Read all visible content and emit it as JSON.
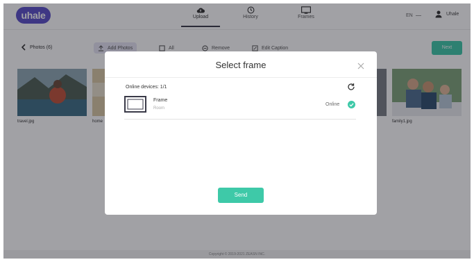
{
  "app": {
    "logo_text": "uhale",
    "nav": [
      {
        "label": "Upload",
        "icon": "cloud-upload-icon",
        "active": true
      },
      {
        "label": "History",
        "icon": "clock-icon",
        "active": false
      },
      {
        "label": "Frames",
        "icon": "frame-icon",
        "active": false
      }
    ],
    "language": "EN",
    "username": "Uhale"
  },
  "toolbar": {
    "back_label": "Photos (6)",
    "add_photos_label": "Add Photos",
    "all_label": "All",
    "remove_label": "Remove",
    "edit_caption_label": "Edit Caption",
    "next_label": "Next"
  },
  "photos": [
    {
      "caption": "travel.jpg",
      "icon": "photo-thumbnail"
    },
    {
      "caption": "home",
      "icon": "photo-thumbnail"
    },
    {
      "caption": "family1.jpg",
      "icon": "photo-thumbnail"
    }
  ],
  "footer_text": "Copyright © 2019-2021 ZEASN INC.",
  "modal": {
    "title": "Select frame",
    "online_devices_label": "Online devices: 1/1",
    "devices": [
      {
        "name": "Frame",
        "room": "Room",
        "status": "Online",
        "selected": true
      }
    ],
    "send_label": "Send"
  },
  "colors": {
    "accent": "#3ec9a8",
    "logo": "#5b4fc9",
    "overlay": "rgba(20,20,30,0.40)"
  }
}
